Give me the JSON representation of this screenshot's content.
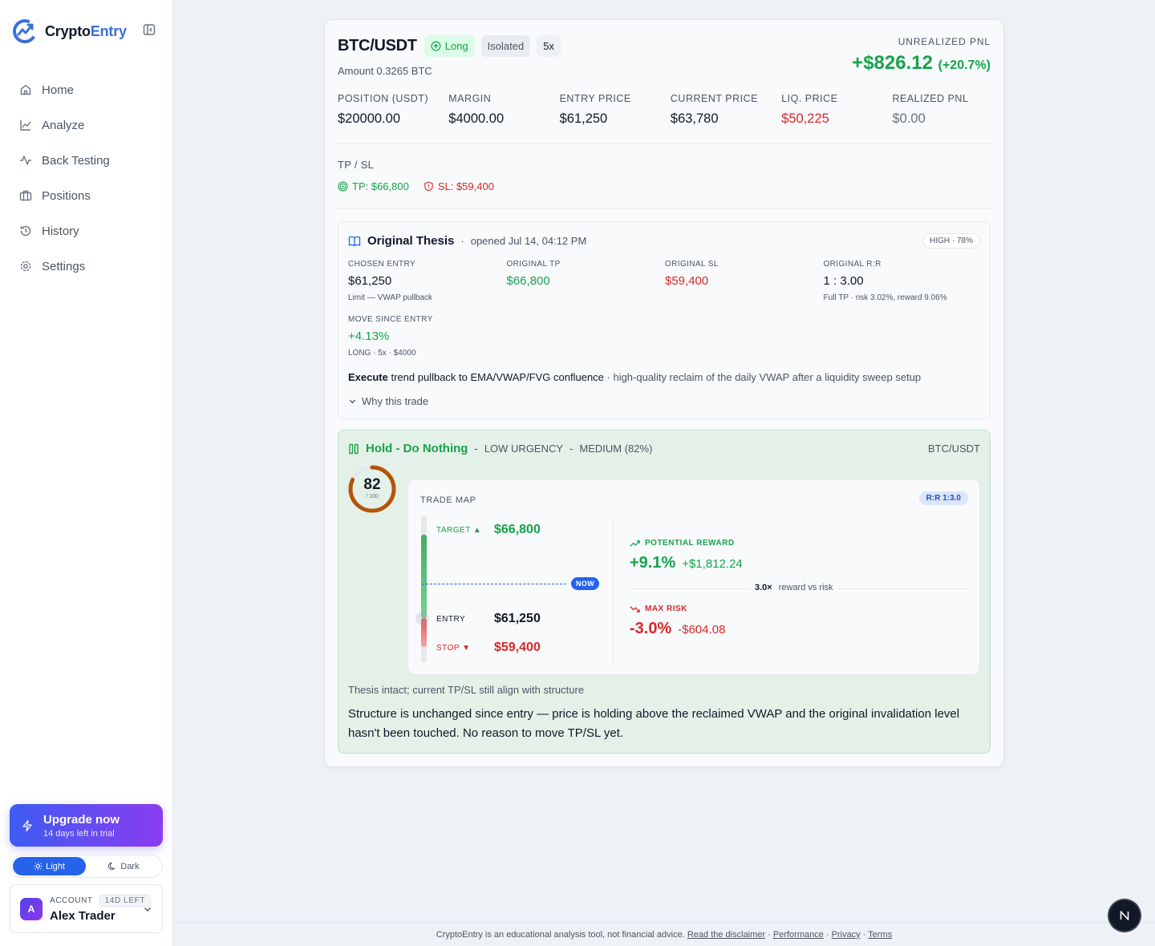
{
  "brand": {
    "name_part1": "Crypto",
    "name_part2": "Entry"
  },
  "nav": [
    {
      "label": "Home",
      "icon": "home-icon"
    },
    {
      "label": "Analyze",
      "icon": "chart-line-icon"
    },
    {
      "label": "Back Testing",
      "icon": "activity-icon"
    },
    {
      "label": "Positions",
      "icon": "briefcase-icon"
    },
    {
      "label": "History",
      "icon": "history-icon"
    },
    {
      "label": "Settings",
      "icon": "gear-icon"
    }
  ],
  "upgrade": {
    "title": "Upgrade now",
    "subtitle": "14 days left in trial"
  },
  "theme": {
    "light": "Light",
    "dark": "Dark",
    "selected": "Light"
  },
  "account": {
    "label": "ACCOUNT",
    "badge": "14D LEFT",
    "name": "Alex Trader",
    "initial": "A"
  },
  "position": {
    "pair": "BTC/USDT",
    "side": "Long",
    "margin_mode": "Isolated",
    "leverage": "5x",
    "amount": "Amount 0.3265 BTC",
    "unrealized_label": "UNREALIZED PNL",
    "unrealized_value": "+$826.12",
    "unrealized_pct": "(+20.7%)",
    "stats": [
      {
        "label": "POSITION (USDT)",
        "value": "$20000.00"
      },
      {
        "label": "MARGIN",
        "value": "$4000.00"
      },
      {
        "label": "ENTRY PRICE",
        "value": "$61,250"
      },
      {
        "label": "CURRENT PRICE",
        "value": "$63,780"
      },
      {
        "label": "LIQ. PRICE",
        "value": "$50,225"
      },
      {
        "label": "REALIZED PNL",
        "value": "$0.00"
      }
    ],
    "tpsl_label": "TP / SL",
    "tp": "TP: $66,800",
    "sl": "SL: $59,400"
  },
  "thesis": {
    "title": "Original Thesis",
    "opened": "opened Jul 14, 04:12 PM",
    "badge": "HIGH · 78%",
    "cols": [
      {
        "label": "CHOSEN ENTRY",
        "value": "$61,250",
        "note": "Limit — VWAP pullback"
      },
      {
        "label": "ORIGINAL TP",
        "value": "$66,800",
        "note": ""
      },
      {
        "label": "ORIGINAL SL",
        "value": "$59,400",
        "note": ""
      },
      {
        "label": "ORIGINAL R:R",
        "value": "1 : 3.00",
        "note": "Full TP · risk 3.02%, reward 9.06%"
      }
    ],
    "move_label": "MOVE SINCE ENTRY",
    "move_value": "+4.13%",
    "move_note": "LONG · 5x · $4000",
    "exec_bold": "Execute",
    "exec_text": " trend pullback to EMA/VWAP/FVG confluence",
    "exec_rest": " · high-quality reclaim of the daily VWAP after a liquidity sweep setup",
    "why": "Why this trade"
  },
  "hold": {
    "title": "Hold - Do Nothing",
    "urgency": "LOW URGENCY",
    "confidence": "MEDIUM (82%)",
    "pair": "BTC/USDT",
    "score": "82",
    "score_max": "/ 100",
    "score_fraction": 0.82,
    "map_label": "TRADE MAP",
    "rr": "R:R 1:3.0",
    "target_label": "TARGET ▲",
    "target_value": "$66,800",
    "entry_label": "ENTRY",
    "entry_value": "$61,250",
    "stop_label": "STOP ▼",
    "stop_value": "$59,400",
    "now_label": "NOW",
    "reward_label": "POTENTIAL REWARD",
    "reward_pct": "+9.1%",
    "reward_usd": "+$1,812.24",
    "ratio_value": "3.0×",
    "ratio_text": "reward vs risk",
    "risk_label": "MAX RISK",
    "risk_pct": "-3.0%",
    "risk_usd": "-$604.08",
    "note": "Thesis intact; current TP/SL still align with structure",
    "description": "Structure is unchanged since entry — price is holding above the reclaimed VWAP and the original invalidation level hasn't been touched. No reason to move TP/SL yet."
  },
  "footer": {
    "text": "CryptoEntry is an educational analysis tool, not financial advice.",
    "links": [
      "Read the disclaimer",
      "Performance",
      "Privacy",
      "Terms"
    ],
    "separator": " · "
  },
  "colors": {
    "green": "#16a34a",
    "red": "#dc2626",
    "accent": "#2563eb",
    "gauge": "#b45309"
  }
}
